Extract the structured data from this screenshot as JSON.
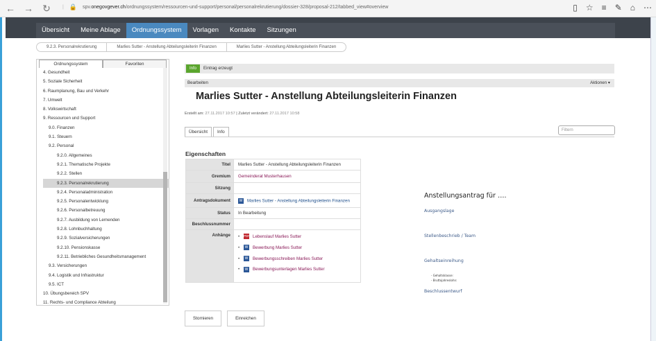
{
  "browser": {
    "url_path_prefix": "spv.",
    "url_domain": "onegovgever.ch",
    "url_path": "/ordnungssystem/ressourcen-und-support/personal/personalrekrutierung/dossier-328/proposal-212/tabbed_view#overview"
  },
  "topnav": [
    "Übersicht",
    "Meine Ablage",
    "Ordnungssystem",
    "Vorlagen",
    "Kontakte",
    "Sitzungen"
  ],
  "breadcrumbs": [
    "9.2.3. Personalrekrutierung",
    "Marlies Sutter - Anstellung Abteilungsleiterin Finanzen",
    "Marlies Sutter - Anstellung Abteilungsleiterin Finanzen"
  ],
  "sidebar": {
    "tabs": [
      "Ordnungssystem",
      "Favoriten"
    ],
    "items": [
      {
        "label": "4. Gesundheit",
        "level": 1
      },
      {
        "label": "5. Soziale Sicherheit",
        "level": 1
      },
      {
        "label": "6. Raumplanung, Bau und Verkehr",
        "level": 1
      },
      {
        "label": "7. Umwelt",
        "level": 1
      },
      {
        "label": "8. Volkswirtschaft",
        "level": 1
      },
      {
        "label": "9. Ressourcen und Support",
        "level": 1
      },
      {
        "label": "9.0. Finanzen",
        "level": 2
      },
      {
        "label": "9.1. Steuern",
        "level": 2
      },
      {
        "label": "9.2. Personal",
        "level": 2
      },
      {
        "label": "9.2.0. Allgemeines",
        "level": 3
      },
      {
        "label": "9.2.1. Thematische Projekte",
        "level": 3
      },
      {
        "label": "9.2.2. Stellen",
        "level": 3
      },
      {
        "label": "9.2.3. Personalrekrutierung",
        "level": 3,
        "selected": true
      },
      {
        "label": "9.2.4. Personaladministration",
        "level": 3
      },
      {
        "label": "9.2.5. Personalentwicklung",
        "level": 3
      },
      {
        "label": "9.2.6. Personalbetreuung",
        "level": 3
      },
      {
        "label": "9.2.7. Ausbildung von Lernenden",
        "level": 3
      },
      {
        "label": "9.2.8. Lohnbuchhaltung",
        "level": 3
      },
      {
        "label": "9.2.9. Sozialversicherungen",
        "level": 3
      },
      {
        "label": "9.2.10. Pensionskasse",
        "level": 3
      },
      {
        "label": "9.2.11. Betriebliches Gesundheitsmanagement",
        "level": 3
      },
      {
        "label": "9.3. Versicherungen",
        "level": 2
      },
      {
        "label": "9.4. Logistik und Infrastruktur",
        "level": 2
      },
      {
        "label": "9.5. ICT",
        "level": 2
      },
      {
        "label": "10. Übungsbereich SPV",
        "level": 1
      },
      {
        "label": "11. Rechts- und Compliance Abteilung",
        "level": 1
      }
    ]
  },
  "main": {
    "status_badge": "Info",
    "status_text": "Eintrag erzeugt",
    "edit_label": "Bearbeiten",
    "actions_label": "Aktionen ▾",
    "title": "Marlies Sutter - Anstellung Abteilungsleiterin Finanzen",
    "created_label": "Erstellt am:",
    "created_value": "27.11.2017 10:57",
    "modified_label": "Zuletzt verändert:",
    "modified_value": "27.11.2017 10:58",
    "tabs": [
      "Übersicht",
      "Info"
    ],
    "filter_placeholder": "Filtern",
    "properties_title": "Eigenschaften",
    "properties": {
      "titel_label": "Titel",
      "titel_value": "Marlies Sutter - Anstellung Abteilungsleiterin Finanzen",
      "gremium_label": "Gremium",
      "gremium_value": "Gemeinderat Musterhausen",
      "sitzung_label": "Sitzung",
      "antrag_label": "Antragsdokument",
      "antrag_value": "Marlies Sutter - Anstellung Abteilungsleiterin Finanzen",
      "status_label": "Status",
      "status_value": "In Bearbeitung",
      "beschluss_label": "Beschlussnummer",
      "anhaenge_label": "Anhänge",
      "anhaenge": [
        {
          "label": "Lebenslauf Marlies Sutter",
          "icon": "pdf-icon"
        },
        {
          "label": "Bewerbung Marlies Sutter",
          "icon": "word-icon"
        },
        {
          "label": "Bewerbungsschreiben Marlies Sutter",
          "icon": "word-icon"
        },
        {
          "label": "Bewerbungsunterlagen Marlies Sutter",
          "icon": "word-icon"
        }
      ]
    },
    "buttons": {
      "cancel": "Stornieren",
      "submit": "Einreichen"
    }
  },
  "preview": {
    "heading": "Anstellungsantrag für ….",
    "s1": "Ausgangslage",
    "s2": "Stellenbeschrieb / Team",
    "s3": "Gehaltseinreihung",
    "b1": "-   Gehaltsklasse:",
    "b2": "-   Bruttojahreslohn:",
    "s4": "Beschlussentwurf"
  },
  "colors": {
    "nav_active": "#4a89bf",
    "nav_bg": "#4a5059",
    "badge": "#5aa52d",
    "link": "#8a1a58"
  }
}
